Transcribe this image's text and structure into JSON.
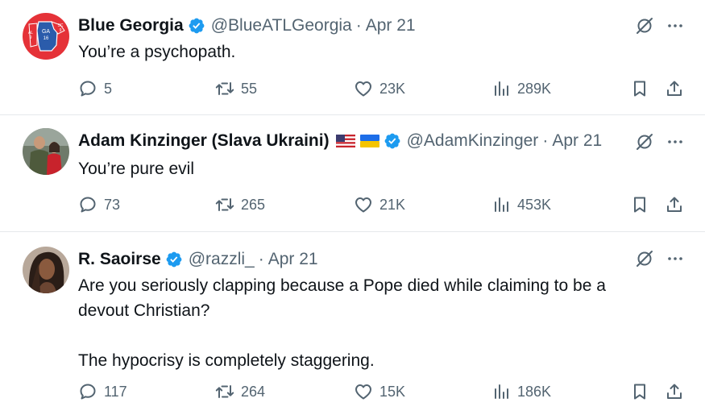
{
  "tweets": [
    {
      "name": "Blue Georgia",
      "handle": "@BlueATLGeorgia",
      "sep": "·",
      "date": "Apr 21",
      "text": "You’re a psychopath.",
      "replies": "5",
      "retweets": "55",
      "likes": "23K",
      "views": "289K",
      "avatar": "georgia-map-avatar",
      "avatar_labels": [
        "GA",
        "16",
        "SC",
        "9",
        "AL",
        "9"
      ]
    },
    {
      "name": "Adam Kinzinger (Slava Ukraini)",
      "handle": "@AdamKinzinger",
      "sep": "·",
      "date": "Apr 21",
      "text": "You’re pure evil",
      "replies": "73",
      "retweets": "265",
      "likes": "21K",
      "views": "453K",
      "avatar": "photo-two-people-avatar",
      "flags": [
        "us-flag",
        "ukraine-flag"
      ]
    },
    {
      "name": "R. Saoirse",
      "handle": "@razzli_",
      "sep": "·",
      "date": "Apr 21",
      "text": "Are you seriously clapping because a Pope died while claiming to be a\ndevout Christian?\n\nThe hypocrisy is completely staggering.",
      "replies": "117",
      "retweets": "264",
      "likes": "15K",
      "views": "186K",
      "avatar": "photo-woman-avatar"
    }
  ],
  "colors": {
    "text": "#0f1419",
    "muted": "#536471",
    "verified": "#1d9bf0",
    "divider": "#e6e9eb",
    "georgia_red": "#e53238",
    "georgia_blue": "#2b5cab"
  },
  "icons": [
    "reply-icon",
    "retweet-icon",
    "like-icon",
    "views-icon",
    "bookmark-icon",
    "share-icon",
    "grok-icon",
    "more-icon",
    "verified-badge-icon"
  ]
}
